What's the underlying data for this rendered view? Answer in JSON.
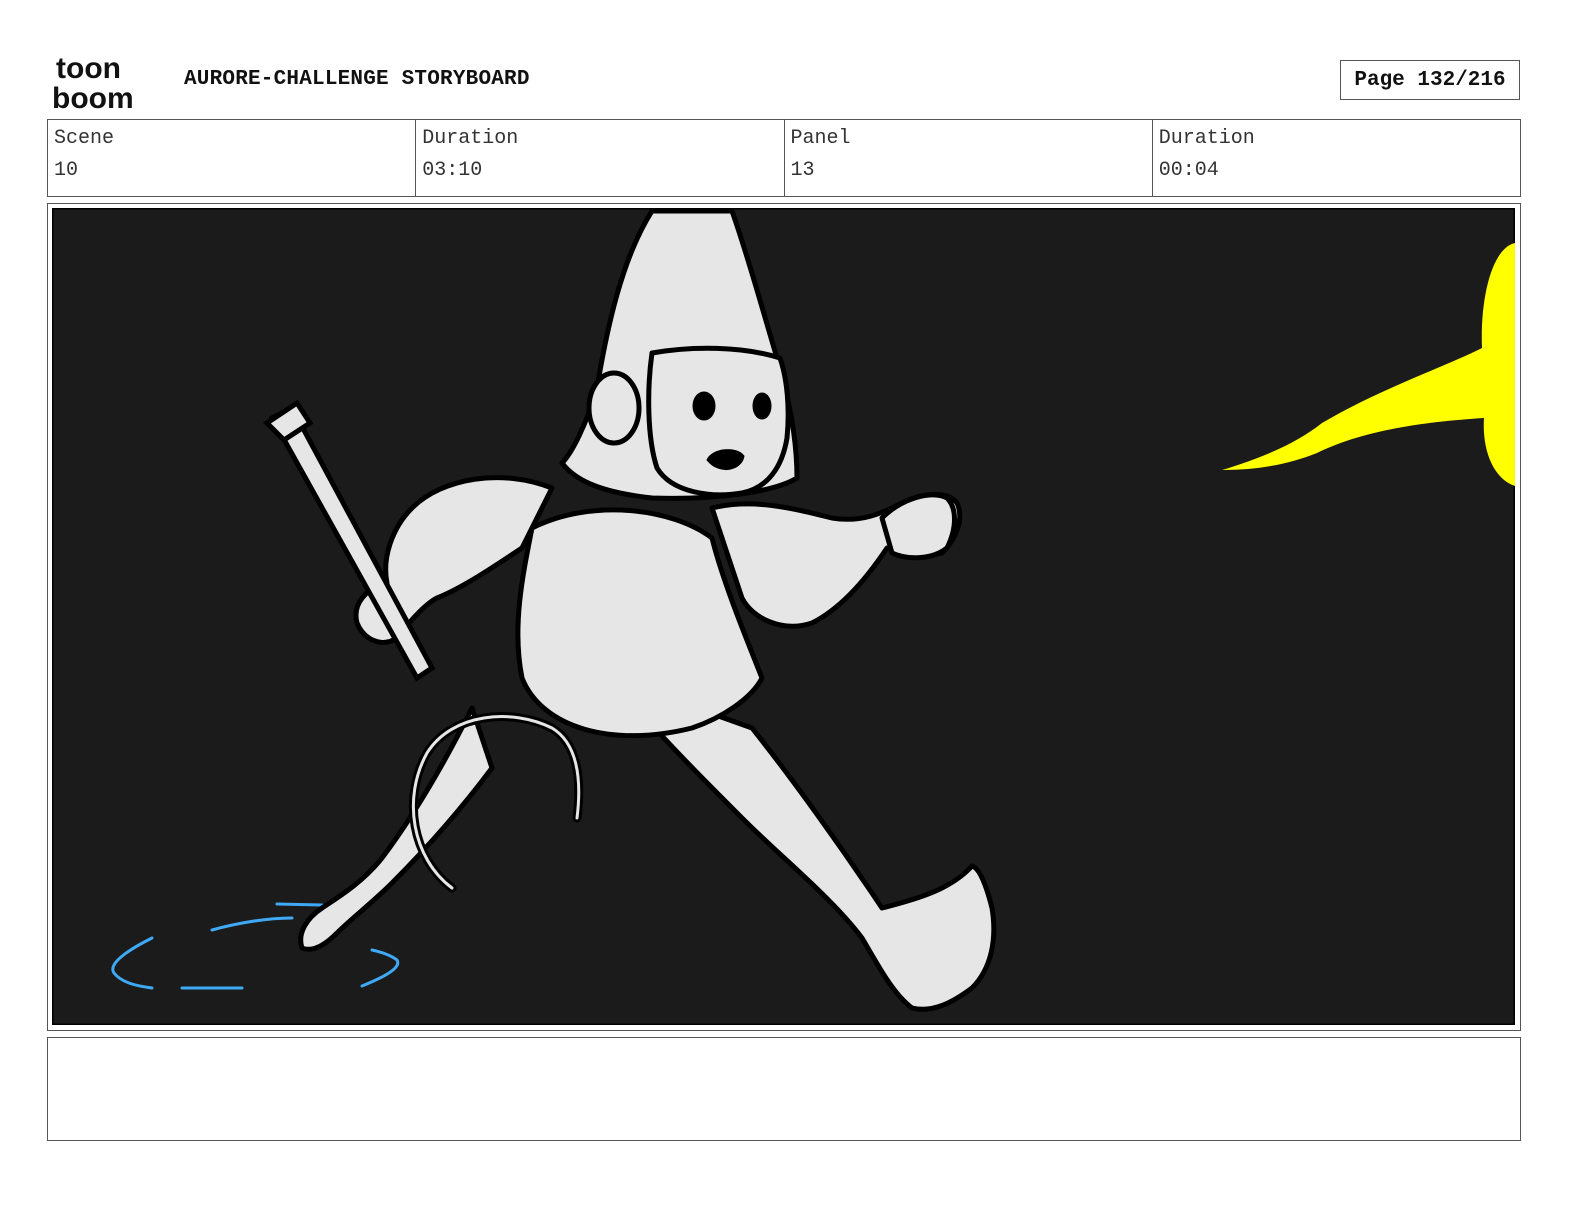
{
  "header": {
    "logo_top": "toon",
    "logo_bottom": "boom",
    "title": "AURORE-CHALLENGE STORYBOARD",
    "page_label": "Page 132/216"
  },
  "info": {
    "scene_label": "Scene",
    "scene_value": "10",
    "scene_duration_label": "Duration",
    "scene_duration_value": "03:10",
    "panel_label": "Panel",
    "panel_value": "13",
    "panel_duration_label": "Duration",
    "panel_duration_value": "00:04"
  },
  "panel": {
    "background_color": "#1b1b1b",
    "figure_fill": "#e6e6e6",
    "light_color": "#ffff00",
    "puddle_color": "#3fa9f5"
  },
  "notes": {
    "text": ""
  }
}
